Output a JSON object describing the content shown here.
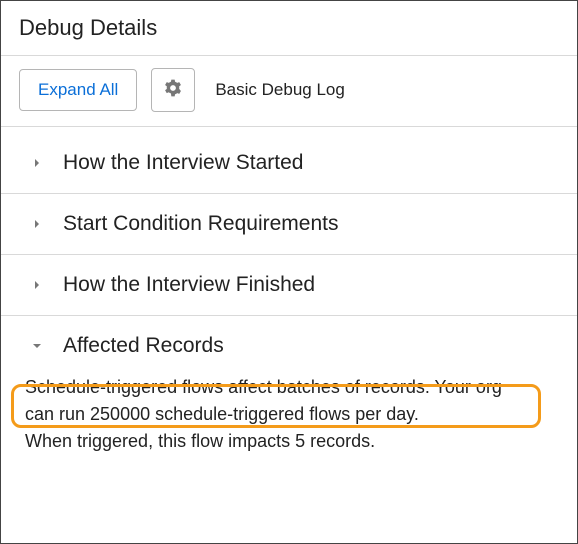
{
  "title": "Debug Details",
  "toolbar": {
    "expand_label": "Expand All",
    "log_label": "Basic Debug Log"
  },
  "sections": [
    {
      "title": "How the Interview Started",
      "expanded": false
    },
    {
      "title": "Start Condition Requirements",
      "expanded": false
    },
    {
      "title": "How the Interview Finished",
      "expanded": false
    },
    {
      "title": "Affected Records",
      "expanded": true
    }
  ],
  "affected_records": {
    "line1": "Schedule-triggered flows affect batches of records. Your org",
    "line2": "can run 250000 schedule-triggered flows per day.",
    "line3": "When triggered, this flow impacts 5 records."
  }
}
